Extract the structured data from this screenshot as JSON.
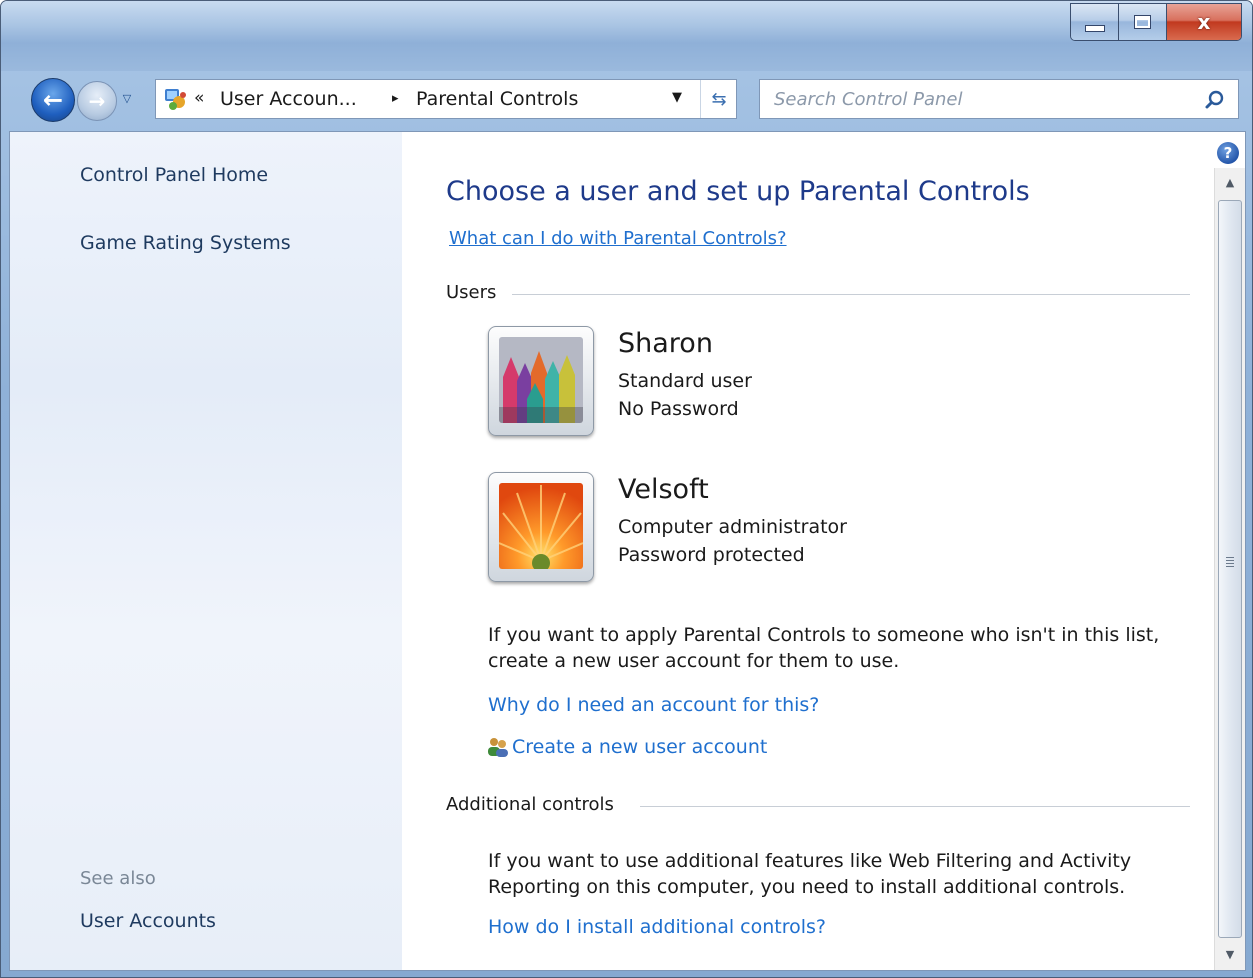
{
  "window": {
    "caption_buttons": {
      "minimize": "minimize",
      "maximize": "maximize",
      "close": "x"
    }
  },
  "nav": {
    "breadcrumb_chevron": "«",
    "breadcrumb_parent": "User Accoun...",
    "breadcrumb_separator": "▸",
    "breadcrumb_current": "Parental Controls",
    "search_placeholder": "Search Control Panel"
  },
  "sidebar": {
    "links": [
      "Control Panel Home",
      "Game Rating Systems"
    ],
    "see_also_label": "See also",
    "see_also_links": [
      "User Accounts"
    ]
  },
  "main": {
    "title": "Choose a user and set up Parental Controls",
    "help_link": "What can I do with Parental Controls?",
    "users_group_label": "Users",
    "users": [
      {
        "name": "Sharon",
        "type": "Standard user",
        "password": "No Password",
        "picture": "crayons"
      },
      {
        "name": "Velsoft",
        "type": "Computer administrator",
        "password": "Password protected",
        "picture": "orange-flower"
      }
    ],
    "no_user_text": "If you want to apply Parental Controls to someone who isn't in this list, create a new user account for them to use.",
    "why_account_link": "Why do I need an account for this?",
    "create_account_link": "Create a new user account",
    "additional_group_label": "Additional controls",
    "additional_text": "If you want to use additional features like Web Filtering and Activity Reporting on this computer, you need to install additional controls.",
    "install_link": "How do I install additional controls?"
  },
  "icons": {
    "back": "back-arrow-icon",
    "forward": "forward-arrow-icon",
    "search": "search-icon",
    "help": "help-icon",
    "refresh": "refresh-icon",
    "create_user": "users-icon"
  },
  "colors": {
    "title_blue": "#1e3a8a",
    "link_blue": "#1f6fce",
    "sidebar_bg": "#e4ecf8"
  }
}
